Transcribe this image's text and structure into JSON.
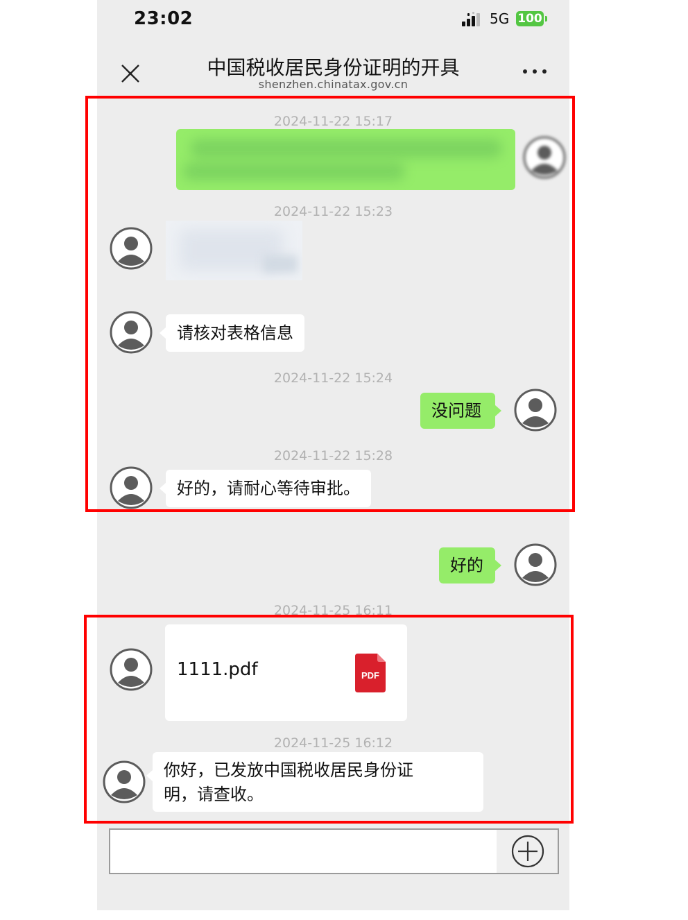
{
  "status_bar": {
    "time": "23:02",
    "network": "5G",
    "battery": "100"
  },
  "header": {
    "title": "中国税收居民身份证明的开具",
    "subtitle": "shenzhen.chinatax.gov.cn",
    "close_icon": "close-icon",
    "more_icon": "more-dots-icon"
  },
  "messages": {
    "ts1": "2024-11-22 15:17",
    "ts2": "2024-11-22 15:23",
    "msg_verify": "请核对表格信息",
    "ts3": "2024-11-22 15:24",
    "msg_no_problem": "没问题",
    "ts4": "2024-11-22 15:28",
    "msg_wait": "好的，请耐心等待审批。",
    "msg_ok": "好的",
    "ts5": "2024-11-25 16:11",
    "file_name": "1111.pdf",
    "file_badge": "PDF",
    "ts6": "2024-11-25 16:12",
    "msg_issued_line1": "你好，已发放中国税收居民身份证",
    "msg_issued_line2": "明，请查收。"
  },
  "input": {
    "placeholder": ""
  },
  "colors": {
    "chat_bg": "#ededed",
    "self_bubble": "#95ec69",
    "other_bubble": "#ffffff",
    "highlight_box": "#ff0000",
    "battery": "#53c642",
    "pdf_red": "#d9202c"
  }
}
